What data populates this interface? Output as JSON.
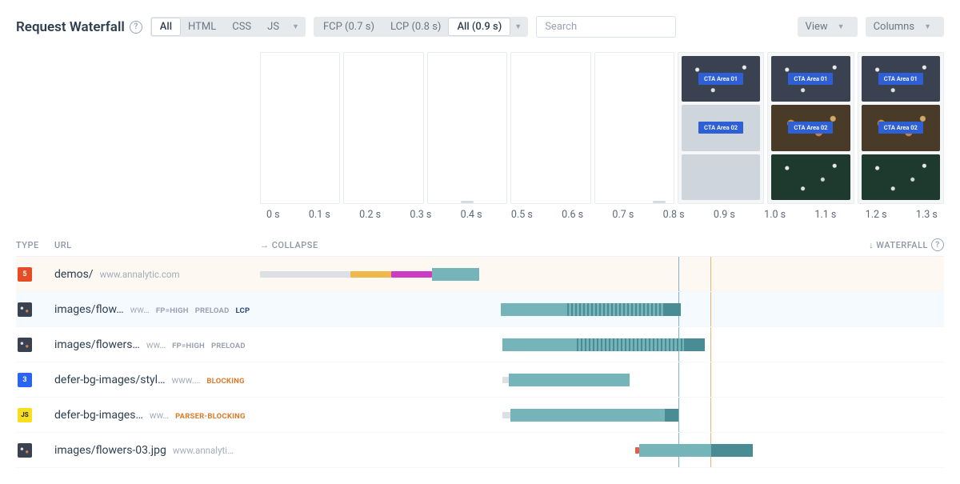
{
  "header": {
    "title": "Request Waterfall",
    "filter_resource": {
      "options": [
        "All",
        "HTML",
        "CSS",
        "JS"
      ],
      "active": "All",
      "has_more": true
    },
    "filter_timing": {
      "options": [
        "FCP (0.7 s)",
        "LCP (0.8 s)",
        "All (0.9 s)"
      ],
      "active": "All (0.9 s)",
      "has_more": true
    },
    "search": {
      "placeholder": "Search",
      "value": ""
    },
    "view_button": "View",
    "columns_button": "Columns"
  },
  "filmstrip": {
    "frames": [
      {
        "state": "empty"
      },
      {
        "state": "empty"
      },
      {
        "state": "empty",
        "scrub": 1
      },
      {
        "state": "empty"
      },
      {
        "state": "empty",
        "scrub": 2
      },
      {
        "state": "filled",
        "cards": [
          "CTA Area 01",
          "CTA Area 02",
          ""
        ],
        "last_placeholder": true
      },
      {
        "state": "filled",
        "cards": [
          "CTA Area 01",
          "CTA Area 02",
          ""
        ]
      },
      {
        "state": "filled",
        "cards": [
          "CTA Area 01",
          "CTA Area 02",
          ""
        ]
      }
    ]
  },
  "axis": {
    "ticks": [
      "0 s",
      "0.1 s",
      "0.2 s",
      "0.3 s",
      "0.4 s",
      "0.5 s",
      "0.6 s",
      "0.7 s",
      "0.8 s",
      "0.9 s",
      "1.0 s",
      "1.1 s",
      "1.2 s",
      "1.3 s"
    ]
  },
  "columns": {
    "type": "TYPE",
    "url": "URL",
    "collapse": "→ COLLAPSE",
    "waterfall": "↓ WATERFALL"
  },
  "markers": {
    "blue_pct": 61.2,
    "orange_pct": 65.8
  },
  "rows": [
    {
      "icon": "html",
      "highlight": "hl",
      "path": "demos/",
      "host": "www.annalytic.com",
      "tags": [],
      "segments": [
        {
          "cls": "thin gray",
          "l": 0,
          "w": 13.2
        },
        {
          "cls": "thin yellow",
          "l": 13.2,
          "w": 6.0
        },
        {
          "cls": "thin magenta",
          "l": 19.2,
          "w": 6.0
        },
        {
          "cls": "teal",
          "l": 25.2,
          "w": 6.8
        }
      ]
    },
    {
      "icon": "img",
      "highlight": "hl2",
      "path": "images/flow…",
      "host": "ww…",
      "tags": [
        {
          "text": "FP=HIGH",
          "cls": "gray"
        },
        {
          "text": "PRELOAD",
          "cls": "gray"
        },
        {
          "text": "LCP",
          "cls": "navy"
        }
      ],
      "segments": [
        {
          "cls": "teal",
          "l": 35.2,
          "w": 9.7
        },
        {
          "cls": "hatch",
          "l": 44.9,
          "w": 14.3
        },
        {
          "cls": "teal-d",
          "l": 59.2,
          "w": 2.3
        }
      ]
    },
    {
      "icon": "img",
      "highlight": "",
      "path": "images/flowers…",
      "host": "ww…",
      "tags": [
        {
          "text": "FP=HIGH",
          "cls": "gray"
        },
        {
          "text": "PRELOAD",
          "cls": "gray"
        }
      ],
      "segments": [
        {
          "cls": "teal",
          "l": 35.4,
          "w": 10.9
        },
        {
          "cls": "hatch",
          "l": 46.3,
          "w": 15.7
        },
        {
          "cls": "teal-d",
          "l": 62.0,
          "w": 3.0
        }
      ]
    },
    {
      "icon": "css",
      "highlight": "",
      "path": "defer-bg-images/styl…",
      "host": "www.…",
      "tags": [
        {
          "text": "BLOCKING",
          "cls": "orange"
        }
      ],
      "segments": [
        {
          "cls": "thin gray",
          "l": 35.4,
          "w": 1.0
        },
        {
          "cls": "teal",
          "l": 36.4,
          "w": 17.6
        }
      ]
    },
    {
      "icon": "js",
      "highlight": "",
      "path": "defer-bg-images…",
      "host": "ww…",
      "tags": [
        {
          "text": "PARSER-BLOCKING",
          "cls": "orange"
        }
      ],
      "segments": [
        {
          "cls": "thin gray",
          "l": 35.4,
          "w": 1.2
        },
        {
          "cls": "teal",
          "l": 36.6,
          "w": 22.6
        },
        {
          "cls": "teal-d",
          "l": 59.2,
          "w": 2.0
        }
      ]
    },
    {
      "icon": "img",
      "highlight": "",
      "path": "images/flowers-03.jpg",
      "host": "www.annalyti…",
      "tags": [],
      "segments": [
        {
          "cls": "thin red",
          "l": 54.8,
          "w": 0.6
        },
        {
          "cls": "teal",
          "l": 55.4,
          "w": 10.6
        },
        {
          "cls": "teal-d",
          "l": 66.0,
          "w": 6.0
        }
      ]
    }
  ]
}
